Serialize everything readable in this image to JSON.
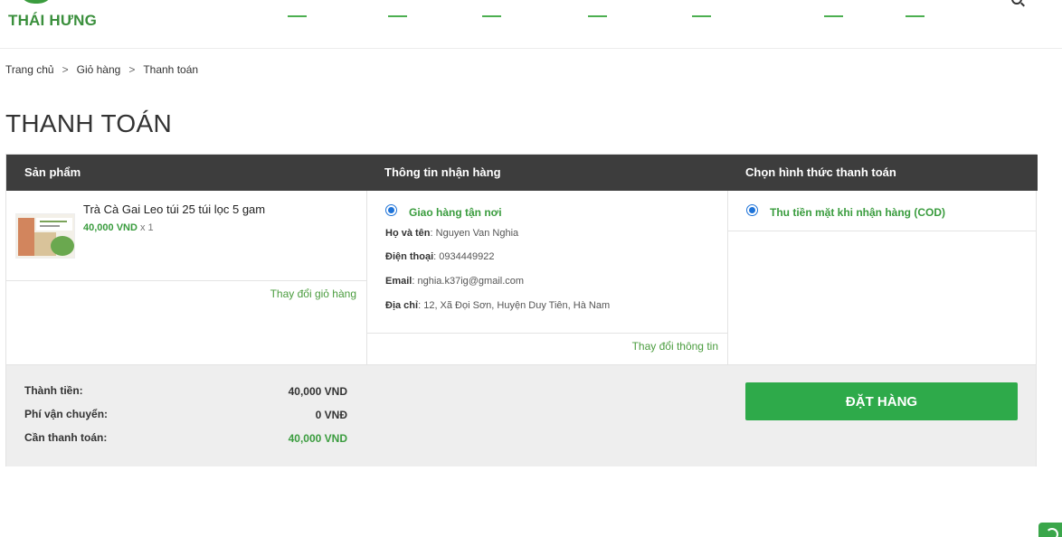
{
  "header": {
    "logo_text": "THÁI HƯNG"
  },
  "breadcrumb": {
    "items": [
      "Trang chủ",
      "Giỏ hàng",
      "Thanh toán"
    ],
    "separator": ">"
  },
  "page_title": "THANH TOÁN",
  "table": {
    "headers": [
      "Sản phẩm",
      "Thông tin nhận hàng",
      "Chọn hình thức thanh toán"
    ]
  },
  "product": {
    "name": "Trà Cà Gai Leo túi 25 túi lọc 5 gam",
    "price": "40,000 VND",
    "qty": "x 1",
    "change_cart_link": "Thay đổi giỏ hàng"
  },
  "shipping": {
    "option_label": "Giao hàng tận nơi",
    "name_label": "Họ và tên",
    "name_value": "Nguyen Van Nghia",
    "phone_label": "Điện thoại",
    "phone_value": "0934449922",
    "email_label": "Email",
    "email_value": "nghia.k37ig@gmail.com",
    "address_label": "Địa chỉ",
    "address_value": "12, Xã Đọi Sơn, Huyện Duy Tiên, Hà Nam",
    "change_info_link": "Thay đổi thông tin"
  },
  "payment": {
    "option_label": "Thu tiền mặt khi nhận hàng (COD)"
  },
  "summary": {
    "subtotal_label": "Thành tiền:",
    "subtotal_value": "40,000 VND",
    "shipping_label": "Phí vận chuyển:",
    "shipping_value": "0 VNĐ",
    "total_label": "Cần thanh toán:",
    "total_value": "40,000 VND"
  },
  "order_button_label": "ĐẶT HÀNG",
  "colors": {
    "accent_green": "#3a9c3e",
    "button_green": "#2eaa4a",
    "header_dark": "#3d3d3d",
    "radio_blue": "#1e73d8"
  }
}
